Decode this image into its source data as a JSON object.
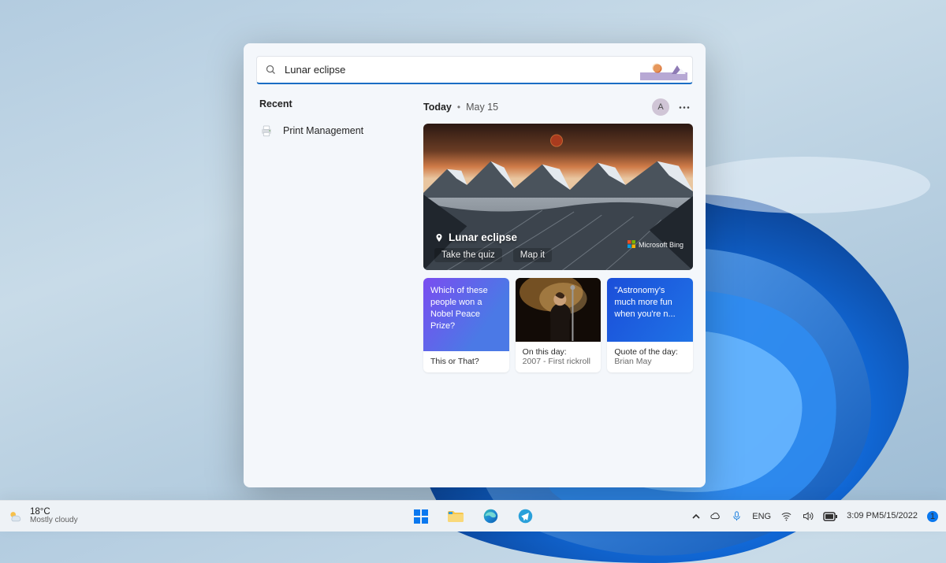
{
  "search": {
    "value": "Lunar eclipse"
  },
  "recent": {
    "heading": "Recent",
    "items": [
      {
        "label": "Print Management"
      }
    ]
  },
  "today": {
    "label": "Today",
    "date": "May 15",
    "avatar_initial": "A"
  },
  "hero": {
    "title": "Lunar eclipse",
    "action1": "Take the quiz",
    "action2": "Map it",
    "brand": "Microsoft Bing"
  },
  "cards": [
    {
      "headline": "Which of these people won a Nobel Peace Prize?",
      "label": "This or That?",
      "sub": ""
    },
    {
      "headline": "",
      "label": "On this day:",
      "sub": "2007 - First rickroll"
    },
    {
      "headline": "\"Astronomy's much more fun when you're n...",
      "label": "Quote of the day:",
      "sub": "Brian May"
    }
  ],
  "taskbar": {
    "weather": {
      "temp": "18°C",
      "desc": "Mostly cloudy"
    },
    "lang": "ENG",
    "time": "3:09 PM",
    "date": "5/15/2022",
    "notif_count": "1"
  }
}
